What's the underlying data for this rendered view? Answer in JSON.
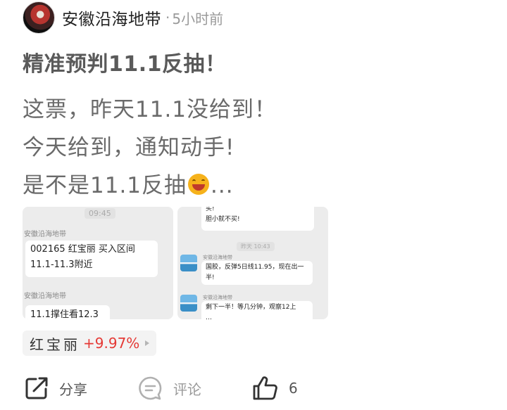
{
  "post": {
    "author": "安徽沿海地带",
    "separator": "·",
    "time": "5小时前",
    "title": "精准预判11.1反抽！",
    "lines": [
      "这票，昨天11.1没给到！",
      "今天给到，通知动手!",
      "是不是11.1反抽",
      "..."
    ],
    "emoji": "grinning-sweat-emoji"
  },
  "screenshot1": {
    "time": "09:45",
    "sender1": "安徽沿海地带",
    "msg1_line1": "002165  红宝丽   买入区间",
    "msg1_line2": "11.1-11.3附近",
    "sender2": "安徽沿海地带",
    "msg2": "11.1撑住看12.3"
  },
  "screenshot2": {
    "msg_top_line1": "买!",
    "msg_top_line2": "胆小就不买!",
    "time": "昨天 10:43",
    "sender1": "安徽沿海地带",
    "msg1_line1": "国胶，反弹5日线11.95，现在出一",
    "msg1_line2": "半!",
    "sender2": "安徽沿海地带",
    "msg2_line1": "剩下一半！等几分钟，观察12上",
    "msg2_line2": "…"
  },
  "stock": {
    "name": "红宝丽",
    "change": "+9.97%",
    "change_color": "#e53935"
  },
  "actions": {
    "share_label": "分享",
    "comment_label": "评论",
    "like_count": "6"
  }
}
